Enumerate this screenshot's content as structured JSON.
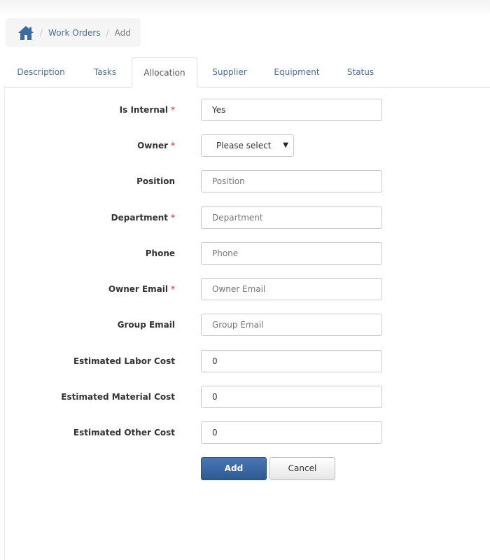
{
  "breadcrumb": {
    "home_icon": "home-icon",
    "items": [
      "Work Orders",
      "Add"
    ],
    "separator": "/"
  },
  "tabs": [
    {
      "label": "Description",
      "active": false
    },
    {
      "label": "Tasks",
      "active": false
    },
    {
      "label": "Allocation",
      "active": true
    },
    {
      "label": "Supplier",
      "active": false
    },
    {
      "label": "Equipment",
      "active": false
    },
    {
      "label": "Status",
      "active": false
    }
  ],
  "form": {
    "required_marker": "*",
    "is_internal": {
      "label": "Is Internal",
      "value": "Yes",
      "required": true
    },
    "owner": {
      "label": "Owner",
      "selected": "Please select",
      "required": true
    },
    "position": {
      "label": "Position",
      "placeholder": "Position",
      "value": ""
    },
    "department": {
      "label": "Department",
      "placeholder": "Department",
      "value": "",
      "required": true
    },
    "phone": {
      "label": "Phone",
      "placeholder": "Phone",
      "value": ""
    },
    "owner_email": {
      "label": "Owner Email",
      "placeholder": "Owner Email",
      "value": "",
      "required": true
    },
    "group_email": {
      "label": "Group Email",
      "placeholder": "Group Email",
      "value": ""
    },
    "estimated_labor_cost": {
      "label": "Estimated Labor Cost",
      "value": "0"
    },
    "estimated_material_cost": {
      "label": "Estimated Material Cost",
      "value": "0"
    },
    "estimated_other_cost": {
      "label": "Estimated Other Cost",
      "value": "0"
    }
  },
  "actions": {
    "add_label": "Add",
    "cancel_label": "Cancel"
  },
  "colors": {
    "link": "#4a6d9c",
    "primary": "#2d5a95",
    "required": "#e02222"
  }
}
